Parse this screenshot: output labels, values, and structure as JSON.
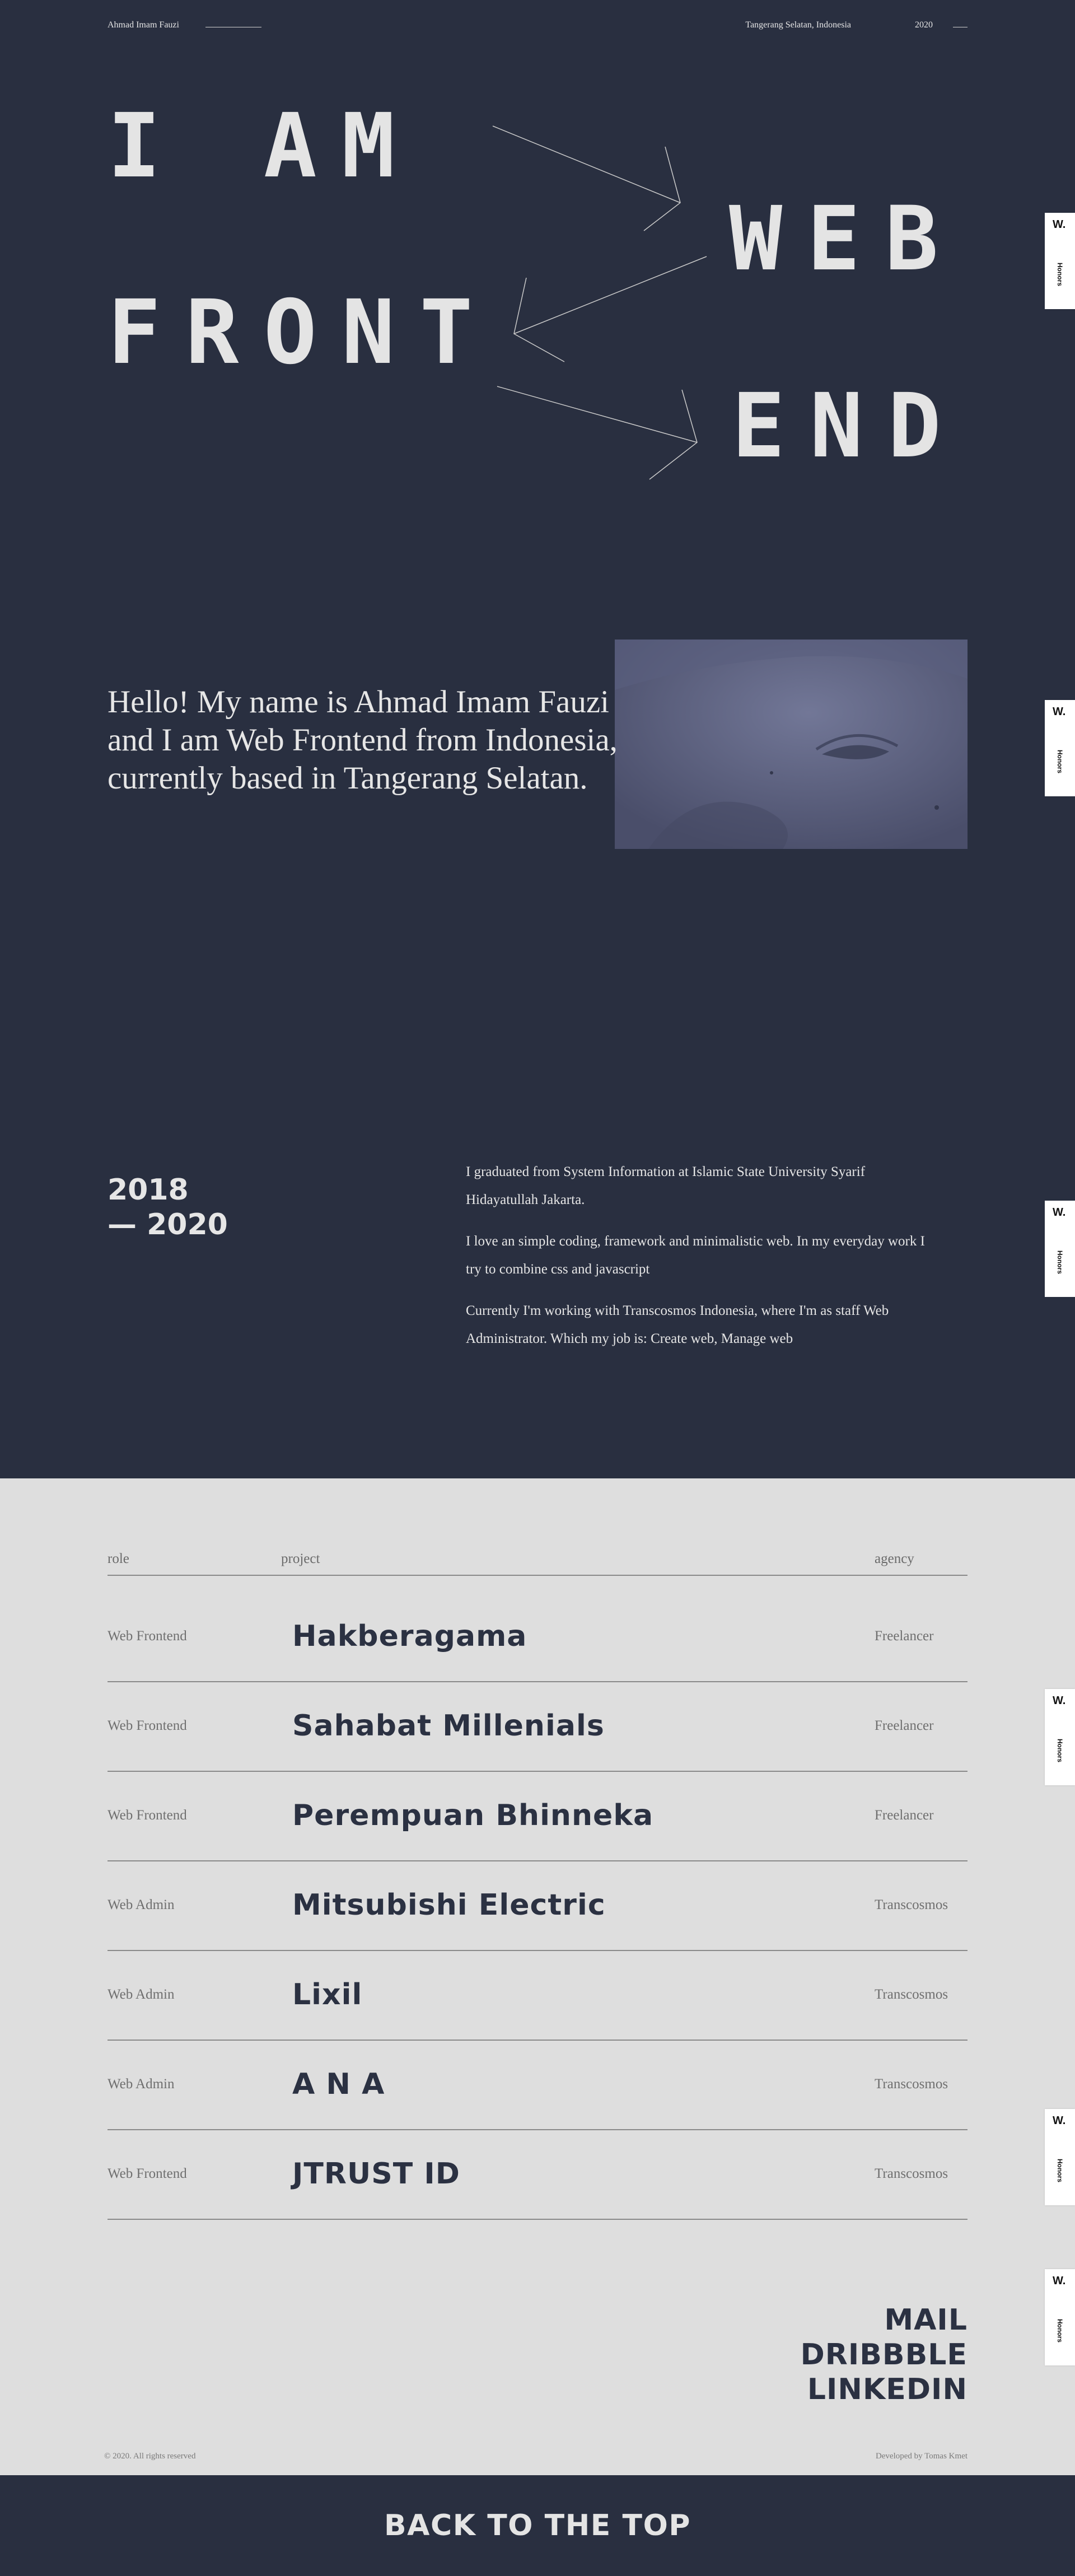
{
  "header": {
    "name": "Ahmad Imam Fauzi",
    "location": "Tangerang Selatan, Indonesia",
    "year": "2020"
  },
  "hero": {
    "line1": "I AM",
    "line2": "FRONT",
    "right1": "WEB",
    "right2": "END"
  },
  "side_tab": {
    "logo": "W.",
    "label": "Honors"
  },
  "intro": {
    "text": "Hello! My name is Ahmad Imam Fauzi and I am Web Frontend from Indonesia, currently based in Tangerang Selatan."
  },
  "about": {
    "years_line1": "2018",
    "years_line2": "— 2020",
    "paragraphs": [
      "I graduated from System Information at Islamic State University Syarif Hidayatullah Jakarta.",
      "I love an simple coding, framework and minimalistic web. In my everyday work I try to combine css and javascript",
      "Currently I'm working with Transcosmos Indonesia, where I'm as staff Web Administrator. Which my job is: Create web, Manage web"
    ]
  },
  "projects": {
    "headers": {
      "role": "role",
      "project": "project",
      "agency": "agency"
    },
    "rows": [
      {
        "role": "Web Frontend",
        "project": "Hakberagama",
        "agency": "Freelancer"
      },
      {
        "role": "Web Frontend",
        "project": "Sahabat Millenials",
        "agency": "Freelancer"
      },
      {
        "role": "Web Frontend",
        "project": "Perempuan Bhinneka",
        "agency": "Freelancer"
      },
      {
        "role": "Web Admin",
        "project": "Mitsubishi Electric",
        "agency": "Transcosmos"
      },
      {
        "role": "Web Admin",
        "project": "Lixil",
        "agency": "Transcosmos"
      },
      {
        "role": "Web Admin",
        "project": "A N A",
        "agency": "Transcosmos"
      },
      {
        "role": "Web Frontend",
        "project": "JTRUST ID",
        "agency": "Transcosmos"
      }
    ]
  },
  "contact": {
    "mail": "MAIL",
    "dribbble": "DRIBBBLE",
    "linkedin": "LINKEDIN"
  },
  "footer": {
    "copyright": "© 2020. All rights reserved",
    "developer": "Developed by Tomas Kmet",
    "back_to_top": "BACK TO THE TOP"
  }
}
